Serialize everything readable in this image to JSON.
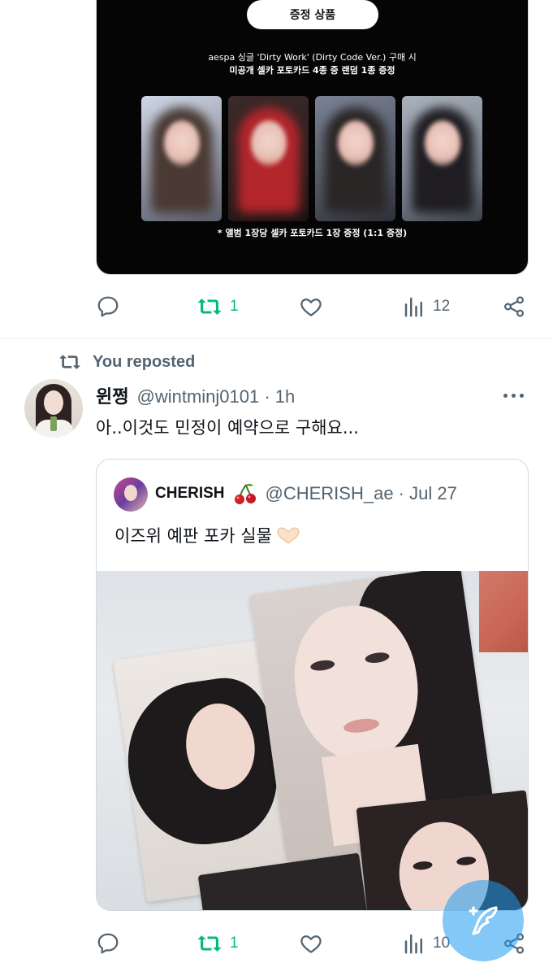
{
  "promo": {
    "pill_label": "증정 상품",
    "line1": "aespa 싱글 'Dirty Work' (Dirty Code Ver.) 구매 시",
    "line2": "미공개 셀카 포토카드 4종 중 랜덤 1종 증정",
    "note": "* 앨범 1장당 셀카 포토카드 1장 증정 (1:1 증정)"
  },
  "tweet1_actions": {
    "retweets": "1",
    "views": "12"
  },
  "repost": {
    "label": "You reposted"
  },
  "tweet2": {
    "name": "윈쩡",
    "handle_time": "@wintminj0101 · 1h",
    "text": "아..이것도 민정이 예약으로 구해요...",
    "quote": {
      "name": "CHERISH",
      "handle_time": "@CHERISH_ae · Jul 27",
      "text": "이즈위 예판 포카 실물"
    },
    "actions": {
      "retweets": "1",
      "views": "10"
    }
  },
  "icons": [
    "reply-icon",
    "retweet-icon",
    "like-icon",
    "views-icon",
    "share-icon",
    "more-icon",
    "cherry-icon",
    "heart-hands-icon",
    "compose-icon"
  ],
  "colors": {
    "retweet_green": "#00ba7c",
    "muted": "#536471",
    "fab": "#1d9bf0"
  }
}
